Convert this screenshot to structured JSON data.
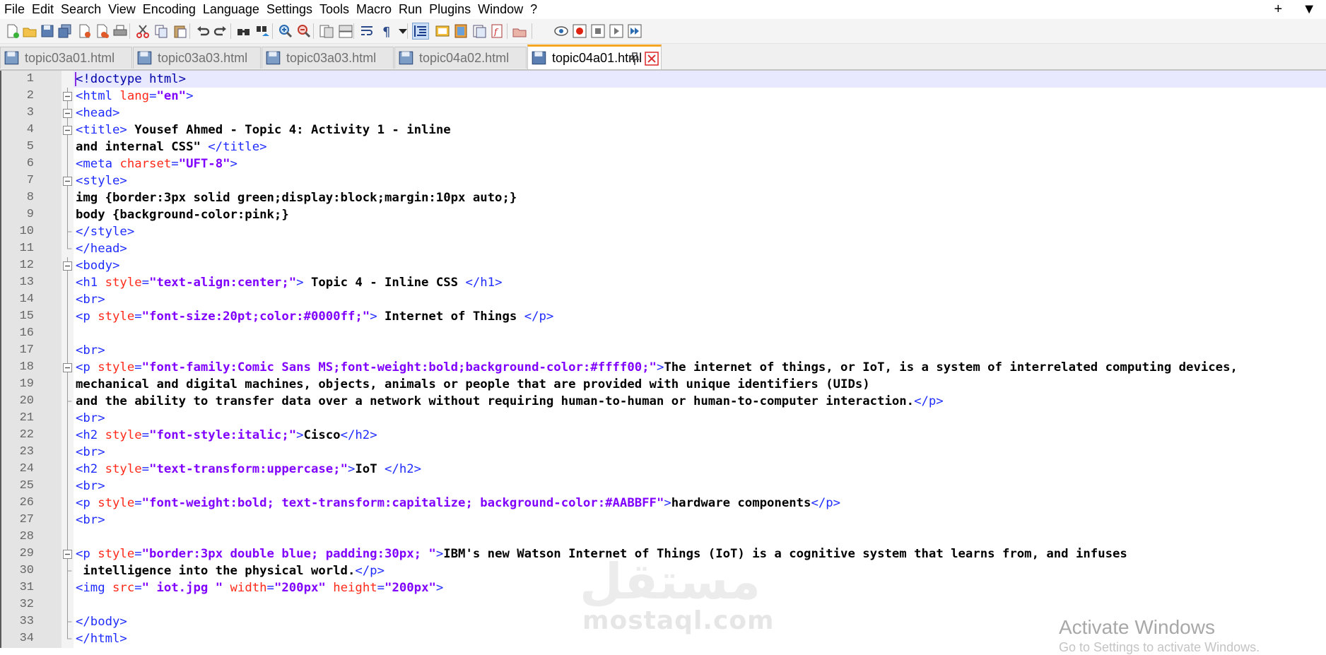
{
  "menu": [
    "File",
    "Edit",
    "Search",
    "View",
    "Encoding",
    "Language",
    "Settings",
    "Tools",
    "Macro",
    "Run",
    "Plugins",
    "Window",
    "?"
  ],
  "menu_right": [
    "+",
    "▼"
  ],
  "toolbar_icons": [
    "new-file-icon",
    "open-file-icon",
    "save-icon",
    "save-all-icon",
    "close-icon",
    "close-all-icon",
    "print-icon",
    "cut-icon",
    "copy-icon",
    "paste-icon",
    "undo-icon",
    "redo-icon",
    "find-icon",
    "replace-icon",
    "zoom-in-icon",
    "zoom-out-icon",
    "sync-vertical-icon",
    "sync-horizontal-icon",
    "word-wrap-icon",
    "show-all-characters-icon",
    "dropdown-icon",
    "indent-guide-icon",
    "udl-icon",
    "doc-map-icon",
    "function-list-icon",
    "folder-workspace-icon",
    "monitor-icon",
    "record-macro-icon",
    "stop-macro-icon",
    "play-macro-icon",
    "run-macro-multiple-icon",
    "save-macro-icon"
  ],
  "tabs": [
    {
      "label": "topic03a01.html",
      "active": false
    },
    {
      "label": "topic03a03.html",
      "active": false
    },
    {
      "label": "topic03a03.html",
      "active": false
    },
    {
      "label": "topic04a02.html",
      "active": false
    },
    {
      "label": "topic04a01.html",
      "active": true
    }
  ],
  "colors": {
    "tag": "#1f2cff",
    "attribute": "#ff2a1a",
    "value": "#8000ff",
    "active_tab_accent": "#f5a623",
    "current_line": "#e8e8ff"
  },
  "lines": [
    {
      "n": "1",
      "fold": "",
      "tokens": [
        [
          "doct",
          "<!doctype html>"
        ]
      ]
    },
    {
      "n": "2",
      "fold": "box",
      "tokens": [
        [
          "tag",
          "<html "
        ],
        [
          "attr",
          "lang"
        ],
        [
          "tag",
          "="
        ],
        [
          "val",
          "\"en\""
        ],
        [
          "tag",
          ">"
        ]
      ]
    },
    {
      "n": "3",
      "fold": "box",
      "tokens": [
        [
          "tag",
          "<head>"
        ]
      ]
    },
    {
      "n": "4",
      "fold": "box",
      "tokens": [
        [
          "tag",
          "<title>"
        ],
        [
          "txt",
          " Yousef Ahmed - Topic 4: Activity 1 - inline"
        ]
      ]
    },
    {
      "n": "5",
      "fold": "line",
      "tokens": [
        [
          "txt",
          "and internal CSS\" "
        ],
        [
          "tag",
          "</title>"
        ]
      ]
    },
    {
      "n": "6",
      "fold": "line",
      "tokens": [
        [
          "tag",
          "<meta "
        ],
        [
          "attr",
          "charset"
        ],
        [
          "tag",
          "="
        ],
        [
          "val",
          "\"UFT-8\""
        ],
        [
          "tag",
          ">"
        ]
      ]
    },
    {
      "n": "7",
      "fold": "box",
      "tokens": [
        [
          "tag",
          "<style>"
        ]
      ]
    },
    {
      "n": "8",
      "fold": "line",
      "tokens": [
        [
          "txt",
          "img {border:3px solid green;display:block;margin:10px auto;}"
        ]
      ]
    },
    {
      "n": "9",
      "fold": "line",
      "tokens": [
        [
          "txt",
          "body {background-color:pink;}"
        ]
      ]
    },
    {
      "n": "10",
      "fold": "end",
      "tokens": [
        [
          "tag",
          "</style>"
        ]
      ]
    },
    {
      "n": "11",
      "fold": "end",
      "tokens": [
        [
          "tag",
          "</head>"
        ]
      ]
    },
    {
      "n": "12",
      "fold": "box",
      "tokens": [
        [
          "tag",
          "<body>"
        ]
      ]
    },
    {
      "n": "13",
      "fold": "line",
      "tokens": [
        [
          "tag",
          "<h1 "
        ],
        [
          "attr",
          "style"
        ],
        [
          "tag",
          "="
        ],
        [
          "val",
          "\"text-align:center;\""
        ],
        [
          "tag",
          ">"
        ],
        [
          "txt",
          " Topic 4 - Inline CSS "
        ],
        [
          "tag",
          "</h1>"
        ]
      ]
    },
    {
      "n": "14",
      "fold": "line",
      "tokens": [
        [
          "tag",
          "<br>"
        ]
      ]
    },
    {
      "n": "15",
      "fold": "line",
      "tokens": [
        [
          "tag",
          "<p "
        ],
        [
          "attr",
          "style"
        ],
        [
          "tag",
          "="
        ],
        [
          "val",
          "\"font-size:20pt;color:#0000ff;\""
        ],
        [
          "tag",
          ">"
        ],
        [
          "txt",
          " Internet of Things "
        ],
        [
          "tag",
          "</p>"
        ]
      ]
    },
    {
      "n": "16",
      "fold": "line",
      "tokens": []
    },
    {
      "n": "17",
      "fold": "line",
      "tokens": [
        [
          "tag",
          "<br>"
        ]
      ]
    },
    {
      "n": "18",
      "fold": "box",
      "tokens": [
        [
          "tag",
          "<p "
        ],
        [
          "attr",
          "style"
        ],
        [
          "tag",
          "="
        ],
        [
          "val",
          "\"font-family:Comic Sans MS;font-weight:bold;background-color:#ffff00;\""
        ],
        [
          "tag",
          ">"
        ],
        [
          "txt",
          "The internet of things, or IoT, is a system of interrelated computing devices,"
        ]
      ]
    },
    {
      "n": "19",
      "fold": "line",
      "tokens": [
        [
          "txt",
          "mechanical and digital machines, objects, animals or people that are provided with unique identifiers (UIDs)"
        ]
      ]
    },
    {
      "n": "20",
      "fold": "end",
      "tokens": [
        [
          "txt",
          "and the ability to transfer data over a network without requiring human-to-human or human-to-computer interaction."
        ],
        [
          "tag",
          "</p>"
        ]
      ]
    },
    {
      "n": "21",
      "fold": "line",
      "tokens": [
        [
          "tag",
          "<br>"
        ]
      ]
    },
    {
      "n": "22",
      "fold": "line",
      "tokens": [
        [
          "tag",
          "<h2 "
        ],
        [
          "attr",
          "style"
        ],
        [
          "tag",
          "="
        ],
        [
          "val",
          "\"font-style:italic;\""
        ],
        [
          "tag",
          ">"
        ],
        [
          "txt",
          "Cisco"
        ],
        [
          "tag",
          "</h2>"
        ]
      ]
    },
    {
      "n": "23",
      "fold": "line",
      "tokens": [
        [
          "tag",
          "<br>"
        ]
      ]
    },
    {
      "n": "24",
      "fold": "line",
      "tokens": [
        [
          "tag",
          "<h2 "
        ],
        [
          "attr",
          "style"
        ],
        [
          "tag",
          "="
        ],
        [
          "val",
          "\"text-transform:uppercase;\""
        ],
        [
          "tag",
          ">"
        ],
        [
          "txt",
          "IoT "
        ],
        [
          "tag",
          "</h2>"
        ]
      ]
    },
    {
      "n": "25",
      "fold": "line",
      "tokens": [
        [
          "tag",
          "<br>"
        ]
      ]
    },
    {
      "n": "26",
      "fold": "line",
      "tokens": [
        [
          "tag",
          "<p "
        ],
        [
          "attr",
          "style"
        ],
        [
          "tag",
          "="
        ],
        [
          "val",
          "\"font-weight:bold; text-transform:capitalize; background-color:#AABBFF\""
        ],
        [
          "tag",
          ">"
        ],
        [
          "txt",
          "hardware components"
        ],
        [
          "tag",
          "</p>"
        ]
      ]
    },
    {
      "n": "27",
      "fold": "line",
      "tokens": [
        [
          "tag",
          "<br>"
        ]
      ]
    },
    {
      "n": "28",
      "fold": "line",
      "tokens": []
    },
    {
      "n": "29",
      "fold": "box",
      "tokens": [
        [
          "tag",
          "<p "
        ],
        [
          "attr",
          "style"
        ],
        [
          "tag",
          "="
        ],
        [
          "val",
          "\"border:3px double blue; padding:30px; \""
        ],
        [
          "tag",
          ">"
        ],
        [
          "txt",
          "IBM's new Watson Internet of Things (IoT) is a cognitive system that learns from, and infuses"
        ]
      ]
    },
    {
      "n": "30",
      "fold": "end",
      "tokens": [
        [
          "txt",
          " intelligence into the physical world."
        ],
        [
          "tag",
          "</p>"
        ]
      ]
    },
    {
      "n": "31",
      "fold": "line",
      "tokens": [
        [
          "tag",
          "<img "
        ],
        [
          "attr",
          "src"
        ],
        [
          "tag",
          "="
        ],
        [
          "val",
          "\" iot.jpg \""
        ],
        [
          "tag",
          " "
        ],
        [
          "attr",
          "width"
        ],
        [
          "tag",
          "="
        ],
        [
          "val",
          "\"200px\""
        ],
        [
          "tag",
          " "
        ],
        [
          "attr",
          "height"
        ],
        [
          "tag",
          "="
        ],
        [
          "val",
          "\"200px\""
        ],
        [
          "tag",
          ">"
        ]
      ]
    },
    {
      "n": "32",
      "fold": "line",
      "tokens": []
    },
    {
      "n": "33",
      "fold": "end",
      "tokens": [
        [
          "tag",
          "</body>"
        ]
      ]
    },
    {
      "n": "34",
      "fold": "end",
      "tokens": [
        [
          "tag",
          "</html>"
        ]
      ]
    }
  ],
  "watermark": {
    "logo": "مستقل",
    "site": "mostaql.com"
  },
  "activation": {
    "title": "Activate Windows",
    "subtitle": "Go to Settings to activate Windows."
  }
}
